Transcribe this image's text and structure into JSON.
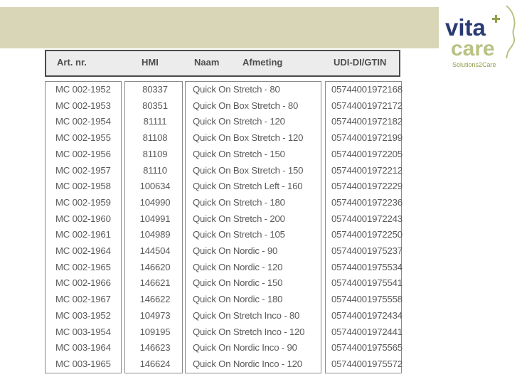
{
  "logo": {
    "line1": "vita",
    "line2": "care",
    "tagline": "Solutions2Care",
    "colors": {
      "primary": "#2a3a72",
      "secondary": "#b9c283",
      "accent": "#8fa04a"
    }
  },
  "colors": {
    "band": "#d8d6b7",
    "header_bg": "#ececec",
    "text": "#5a5a5a"
  },
  "table": {
    "headers": {
      "art": "Art. nr.",
      "hmi": "HMI",
      "naam": "Naam",
      "afmeting": "Afmeting",
      "udi": "UDI-DI/GTIN"
    },
    "rows": [
      {
        "art": "MC 002-1952",
        "hmi": "80337",
        "naam": "Quick On Stretch - 80",
        "udi": "05744001972168"
      },
      {
        "art": "MC 002-1953",
        "hmi": "80351",
        "naam": "Quick On Box Stretch - 80",
        "udi": "05744001972172"
      },
      {
        "art": "MC 002-1954",
        "hmi": "81111",
        "naam": "Quick On Stretch - 120",
        "udi": "05744001972182"
      },
      {
        "art": "MC 002-1955",
        "hmi": "81108",
        "naam": "Quick On Box Stretch - 120",
        "udi": "05744001972199"
      },
      {
        "art": "MC 002-1956",
        "hmi": "81109",
        "naam": "Quick On Stretch - 150",
        "udi": "05744001972205"
      },
      {
        "art": "MC 002-1957",
        "hmi": "81110",
        "naam": "Quick On Box Stretch - 150",
        "udi": "05744001972212"
      },
      {
        "art": "MC 002-1958",
        "hmi": "100634",
        "naam": "Quick On Stretch Left - 160",
        "udi": "05744001972229"
      },
      {
        "art": "MC 002-1959",
        "hmi": "104990",
        "naam": "Quick On Stretch - 180",
        "udi": "05744001972236"
      },
      {
        "art": "MC 002-1960",
        "hmi": "104991",
        "naam": "Quick On Stretch - 200",
        "udi": "05744001972243"
      },
      {
        "art": "MC 002-1961",
        "hmi": "104989",
        "naam": "Quick On Stretch - 105",
        "udi": "05744001972250"
      },
      {
        "art": "MC 002-1964",
        "hmi": "144504",
        "naam": "Quick On Nordic - 90",
        "udi": "05744001975237"
      },
      {
        "art": "MC 002-1965",
        "hmi": "146620",
        "naam": "Quick On Nordic - 120",
        "udi": "05744001975534"
      },
      {
        "art": "MC 002-1966",
        "hmi": "146621",
        "naam": "Quick On Nordic - 150",
        "udi": "05744001975541"
      },
      {
        "art": "MC 002-1967",
        "hmi": "146622",
        "naam": "Quick On Nordic - 180",
        "udi": "05744001975558"
      },
      {
        "art": "MC 003-1952",
        "hmi": "104973",
        "naam": "Quick On Stretch Inco - 80",
        "udi": "05744001972434"
      },
      {
        "art": "MC 003-1954",
        "hmi": "109195",
        "naam": "Quick On Stretch Inco - 120",
        "udi": "05744001972441"
      },
      {
        "art": "MC 003-1964",
        "hmi": "146623",
        "naam": "Quick On Nordic Inco - 90",
        "udi": "05744001975565"
      },
      {
        "art": "MC 003-1965",
        "hmi": "146624",
        "naam": "Quick On Nordic Inco - 120",
        "udi": "05744001975572"
      }
    ]
  }
}
